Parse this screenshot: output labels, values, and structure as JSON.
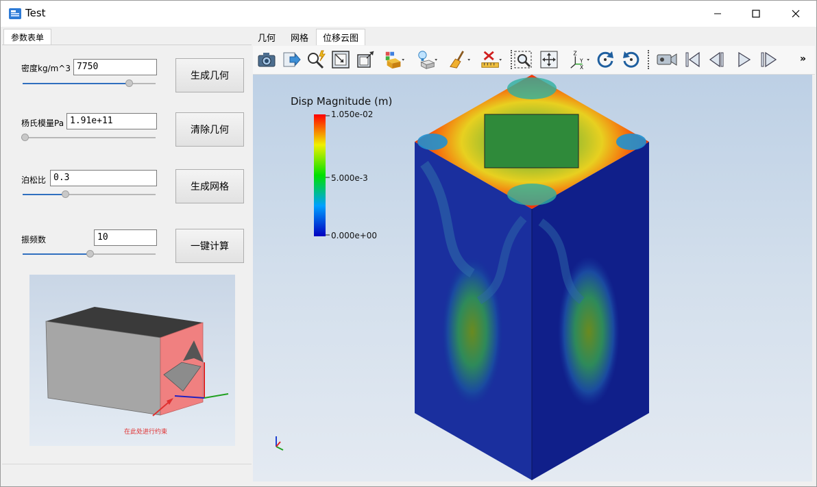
{
  "window": {
    "title": "Test"
  },
  "left_tab": {
    "label": "参数表单"
  },
  "params": {
    "density": {
      "label": "密度kg/m^3",
      "value": "7750",
      "slider": 0.82
    },
    "youngs": {
      "label": "杨氏模量Pa",
      "value": "1.91e+11",
      "slider": 0.0
    },
    "poisson": {
      "label": "泊松比",
      "value": "0.3",
      "slider": 0.31
    },
    "modes": {
      "label": "振频数",
      "value": "10",
      "slider": 0.51
    }
  },
  "buttons": {
    "gen_geometry": "生成几何",
    "clear_geometry": "清除几何",
    "gen_mesh": "生成网格",
    "compute": "一键计算"
  },
  "preview": {
    "annotation": "在此处进行约束"
  },
  "view_tabs": [
    {
      "label": "几何"
    },
    {
      "label": "网格"
    },
    {
      "label": "位移云图"
    }
  ],
  "active_view_tab": "位移云图",
  "toolbar": {
    "icons": [
      "camera-icon",
      "export-icon",
      "magic-search-icon",
      "fit-frame-icon",
      "window-corner-icon",
      "display-mode-icon",
      "light-icon",
      "clear-broom-icon",
      "measure-ruler-icon",
      "zoom-box-icon",
      "pan-icon",
      "axes-icon",
      "rotate-ccw-icon",
      "rotate-cw-icon",
      "video-camera-icon",
      "first-frame-icon",
      "prev-frame-icon",
      "play-icon",
      "next-frame-icon"
    ],
    "overflow": "»"
  },
  "legend": {
    "title": "Disp Magnitude (m)",
    "max": "1.050e-02",
    "mid": "5.000e-3",
    "min": "0.000e+00"
  },
  "colors": {
    "accent": "#2f6fbf",
    "constraint_face": "#f08080",
    "annotation": "#e03030"
  }
}
